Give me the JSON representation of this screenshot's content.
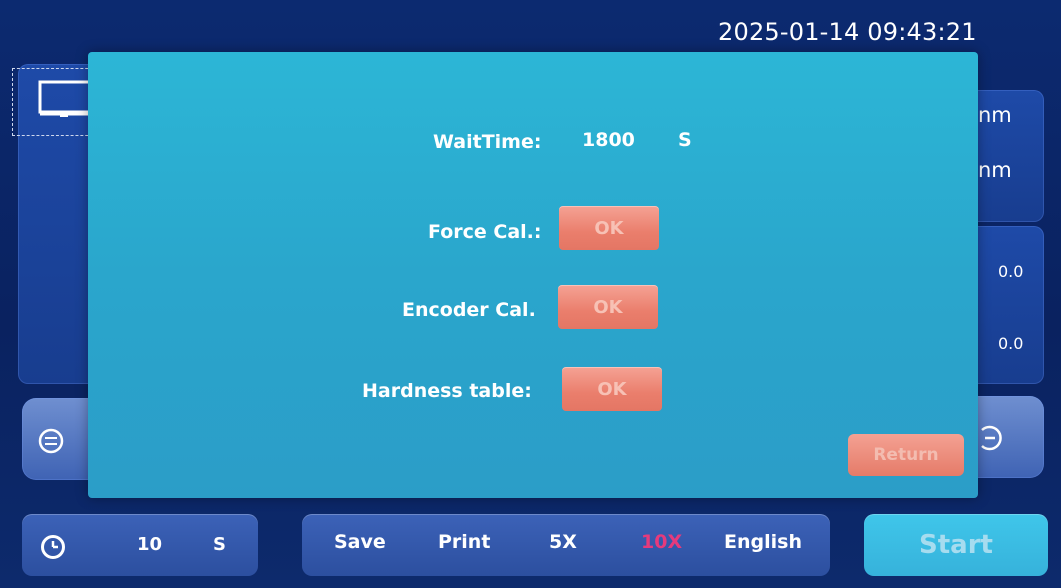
{
  "header": {
    "datetime": "2025-01-14 09:43:21"
  },
  "background": {
    "unit_top": "nm",
    "unit_bottom": "nm",
    "value_1": "0.0",
    "value_2": "0.0"
  },
  "dialog": {
    "wait_time_label": "WaitTime:",
    "wait_time_value": "1800",
    "wait_time_unit": "S",
    "force_cal_label": "Force Cal.:",
    "encoder_cal_label": "Encoder Cal.",
    "hardness_table_label": "Hardness table:",
    "ok_label": "OK",
    "return_label": "Return"
  },
  "bottom_bar": {
    "timer_value": "10",
    "timer_unit": "S",
    "save_label": "Save",
    "print_label": "Print",
    "mag_5x_label": "5X",
    "mag_10x_label": "10X",
    "language_label": "English",
    "start_label": "Start"
  },
  "colors": {
    "dialog_bg": "#2cb6d6",
    "ok_button": "#ea7e6c",
    "active_magnification": "#e63a7c",
    "start_button": "#3fc6ea",
    "screen_bg": "#0c2a70"
  },
  "icons": [
    "monitor-icon",
    "swap-icon",
    "minus-circle-icon",
    "clock-icon"
  ]
}
